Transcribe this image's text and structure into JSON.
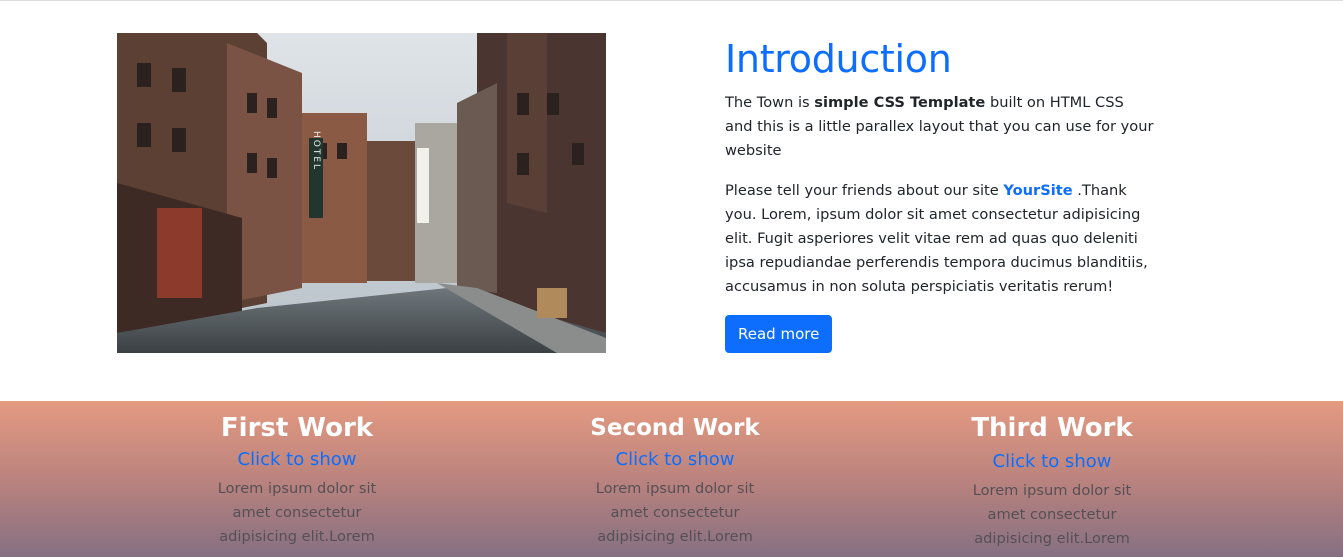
{
  "intro": {
    "image_alt": "Empty town street with brick buildings and a HOTEL sign",
    "heading": "Introduction",
    "p1": {
      "part1": "The Town is ",
      "bold": "simple CSS Template",
      "part2": " built on HTML CSS and this is a little parallex layout that you can use for your website"
    },
    "p2": {
      "part1": "Please tell your friends about our site ",
      "site": "YourSite",
      "part2": " .Thank you. Lorem, ipsum dolor sit amet consectetur adipisicing elit. Fugit asperiores velit vitae rem ad quas quo deleniti ipsa repudiandae perferendis tempora ducimus blanditiis, accusamus in non soluta perspiciatis veritatis rerum!"
    },
    "button": "Read more"
  },
  "works": [
    {
      "title": "First Work",
      "link": "Click to show",
      "text": "Lorem ipsum dolor sit amet consectetur adipisicing elit.Lorem"
    },
    {
      "title": "Second Work",
      "link": "Click to show",
      "text": "Lorem ipsum dolor sit amet consectetur adipisicing elit.Lorem"
    },
    {
      "title": "Third Work",
      "link": "Click to show",
      "text": "Lorem ipsum dolor sit amet consectetur adipisicing elit.Lorem"
    }
  ],
  "photo_signs": {
    "hotel": "HOTEL"
  },
  "colors": {
    "primary": "#0d6efd",
    "band_top": "#e49a80",
    "band_bottom": "#857082"
  }
}
